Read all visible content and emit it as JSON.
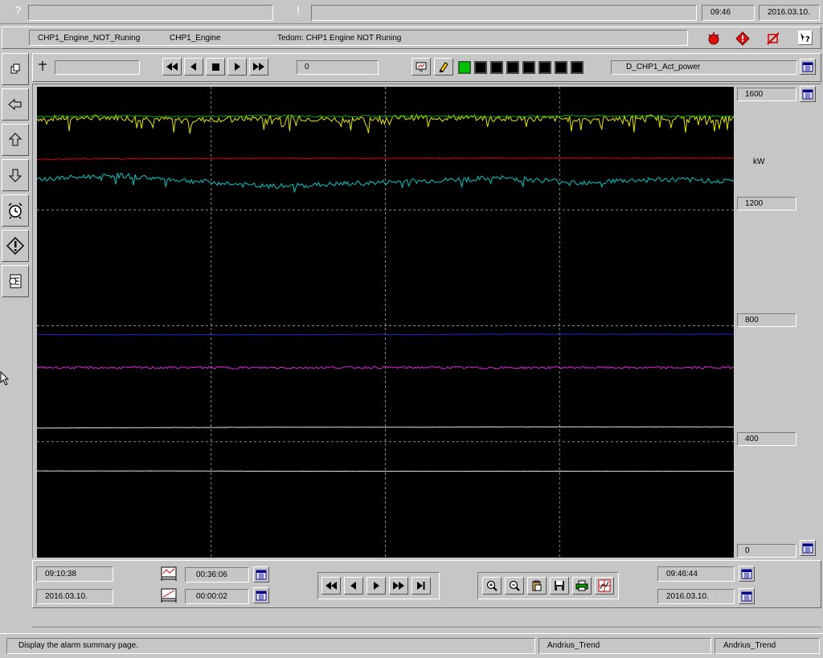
{
  "titlebar": {
    "help_glyph": "?",
    "alert_glyph": "!",
    "time": "09:46",
    "date": "2016.03.10."
  },
  "alarm_bar": {
    "tag": "CHP1_Engine_NOT_Runing",
    "group": "CHP1_Engine",
    "description": "Tedom: CHP1 Engine NOT Runing"
  },
  "trend_toolbar": {
    "cursor_value": "0",
    "pen_name": "D_CHP1_Act_power",
    "indicators": [
      {
        "color": "#00c000"
      },
      {
        "color": "#000000"
      },
      {
        "color": "#000000"
      },
      {
        "color": "#000000"
      },
      {
        "color": "#000000"
      },
      {
        "color": "#000000"
      },
      {
        "color": "#000000"
      },
      {
        "color": "#000000"
      }
    ]
  },
  "scale": {
    "unit": "kW",
    "labels": [
      "1600",
      "1200",
      "800",
      "400",
      "0"
    ]
  },
  "timebar": {
    "start_time": "09:10:38",
    "start_date": "2016.03.10.",
    "span": "00:36:06",
    "step": "00:00:02",
    "end_time": "09:46:44",
    "end_date": "2016.03.10."
  },
  "statusbar": {
    "message": "Display the alarm summary page.",
    "user1": "Andrius_Trend",
    "user2": "Andrius_Trend"
  },
  "chart_data": {
    "type": "line",
    "ylim": [
      0,
      1600
    ],
    "unit": "kW",
    "grid": true,
    "series": [
      {
        "color": "#e8e800",
        "approx_values": [
          1515,
          1520,
          1510,
          1518,
          1512,
          1520,
          1516,
          1514,
          1519,
          1515
        ]
      },
      {
        "color": "#00b000",
        "approx_values": [
          1522,
          1524,
          1522,
          1525,
          1523,
          1524,
          1522,
          1525,
          1523,
          1524
        ]
      },
      {
        "color": "#e00000",
        "approx_values": [
          1375,
          1376,
          1377,
          1378,
          1378,
          1378,
          1379,
          1379,
          1379,
          1379
        ]
      },
      {
        "color": "#00c8c8",
        "approx_values": [
          1305,
          1320,
          1300,
          1280,
          1290,
          1300,
          1310,
          1295,
          1305,
          1300
        ]
      },
      {
        "color": "#2020e0",
        "approx_values": [
          770,
          769,
          769,
          769,
          770,
          770,
          771,
          771,
          771,
          771
        ]
      },
      {
        "color": "#e020e0",
        "approx_values": [
          656,
          655,
          656,
          655,
          656,
          656,
          655,
          656,
          655,
          656
        ]
      },
      {
        "color": "#e0e0e0",
        "approx_values": [
          447,
          448,
          449,
          450,
          450,
          450,
          451,
          451,
          451,
          451
        ]
      },
      {
        "color": "#e0e0e0",
        "approx_values": [
          299,
          299,
          299,
          298,
          298,
          298,
          298,
          298,
          298,
          298
        ]
      }
    ]
  }
}
